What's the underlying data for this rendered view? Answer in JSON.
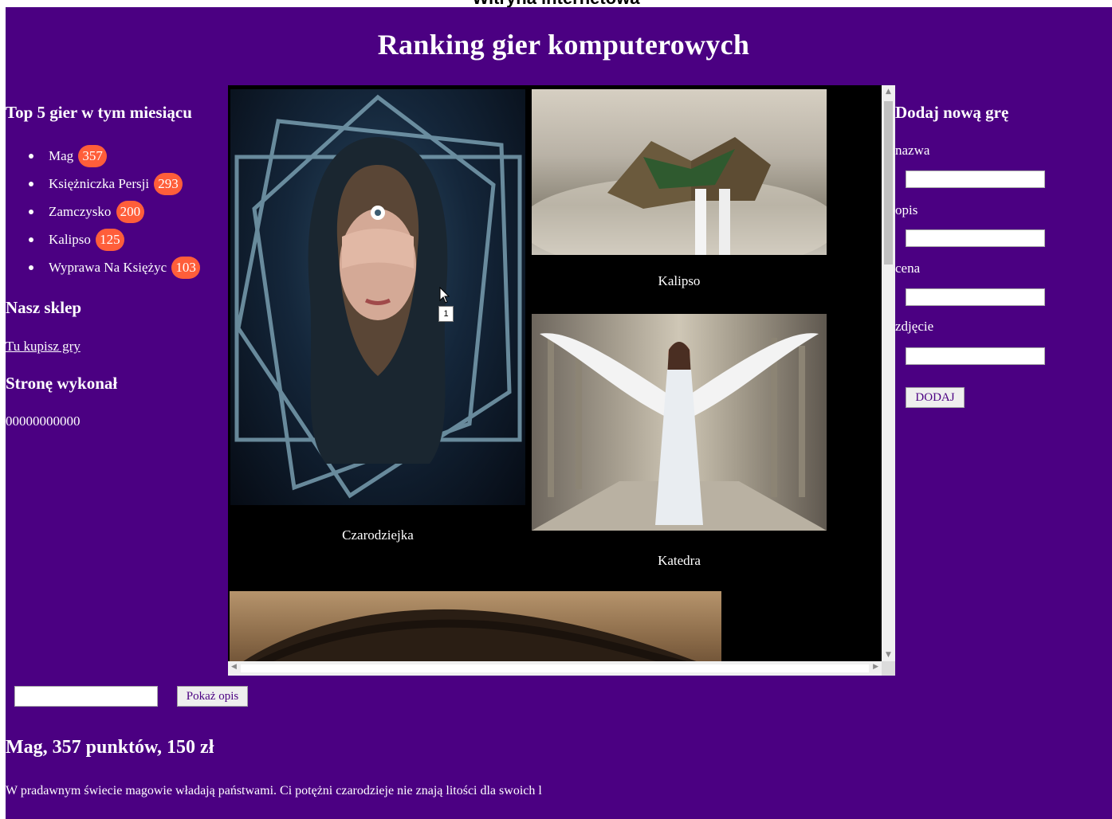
{
  "window": {
    "tab_title": "Witryna internetowa"
  },
  "header": {
    "title": "Ranking gier komputerowych"
  },
  "left": {
    "top_heading": "Top 5 gier w tym miesiącu",
    "top_games": [
      {
        "name": "Mag",
        "score": "357"
      },
      {
        "name": "Księżniczka Persji",
        "score": "293"
      },
      {
        "name": "Zamczysko",
        "score": "200"
      },
      {
        "name": "Kalipso",
        "score": "125"
      },
      {
        "name": "Wyprawa Na Księżyc",
        "score": "103"
      }
    ],
    "shop_heading": "Nasz sklep",
    "shop_link": "Tu kupisz gry",
    "author_heading": "Stronę wykonał",
    "author_value": "00000000000"
  },
  "gallery": {
    "items": [
      {
        "caption": "Czarodziejka"
      },
      {
        "caption": "Kalipso"
      },
      {
        "caption": "Katedra"
      }
    ],
    "tooltip": "1"
  },
  "form": {
    "heading": "Dodaj nową grę",
    "fields": [
      {
        "label": "nazwa",
        "value": ""
      },
      {
        "label": "opis",
        "value": ""
      },
      {
        "label": "cena",
        "value": ""
      },
      {
        "label": "zdjęcie",
        "value": ""
      }
    ],
    "submit_label": "DODAJ"
  },
  "bottom": {
    "search_value": "",
    "show_button_label": "Pokaż opis",
    "desc_title": "Mag, 357 punktów, 150 zł",
    "desc_text": "W pradawnym świecie magowie władają państwami. Ci potężni czarodzieje nie znają litości dla swoich l"
  },
  "colors": {
    "background": "#4b0082",
    "badge": "#ff5e3a",
    "gallery_bg": "#000000"
  },
  "icons": [
    "mouse-cursor-icon",
    "scroll-up-arrow-icon",
    "scroll-down-arrow-icon",
    "scroll-left-arrow-icon",
    "scroll-right-arrow-icon"
  ]
}
